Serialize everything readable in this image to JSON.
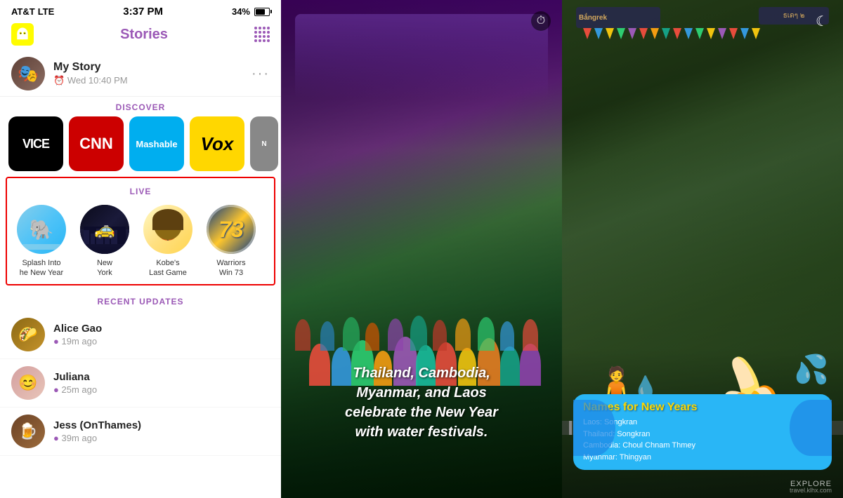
{
  "statusBar": {
    "carrier": "AT&T",
    "network": "LTE",
    "time": "3:37 PM",
    "battery": "34%"
  },
  "header": {
    "title": "Stories",
    "icon": "ghost"
  },
  "myStory": {
    "name": "My Story",
    "time": "Wed 10:40 PM"
  },
  "discover": {
    "label": "DISCOVER",
    "channels": [
      {
        "name": "VICE",
        "bg": "vice"
      },
      {
        "name": "CNN",
        "bg": "cnn"
      },
      {
        "name": "Mashable",
        "bg": "mashable"
      },
      {
        "name": "Vox",
        "bg": "vox"
      },
      {
        "name": "NG",
        "bg": "ng"
      }
    ]
  },
  "live": {
    "label": "LIVE",
    "items": [
      {
        "label": "Splash Into\nhe New Year",
        "icon": "elephant"
      },
      {
        "label": "New\nYork",
        "icon": "taxi"
      },
      {
        "label": "Kobe's\nLast Game",
        "icon": "face"
      },
      {
        "label": "Warriors\nWin 73",
        "icon": "73"
      }
    ]
  },
  "recentUpdates": {
    "label": "RECENT UPDATES",
    "items": [
      {
        "name": "Alice Gao",
        "time": "19m ago"
      },
      {
        "name": "Juliana",
        "time": "25m ago"
      },
      {
        "name": "Jess (OnThames)",
        "time": "39m ago"
      }
    ]
  },
  "middlePanel": {
    "caption": "Thailand, Cambodia,\nMyanmar, and Laos\ncelebrate the New Year\nwith water festivals."
  },
  "rightPanel": {
    "bubble": {
      "title": "Names for New Years",
      "lines": [
        "Laos: Songkran",
        "Thailand: Songkran",
        "Cambodia: Choul Chnam Thmey",
        "Myanmar: Thingyan"
      ]
    },
    "explore": "EXPLORE",
    "watermark": "travel.klhx.com"
  }
}
